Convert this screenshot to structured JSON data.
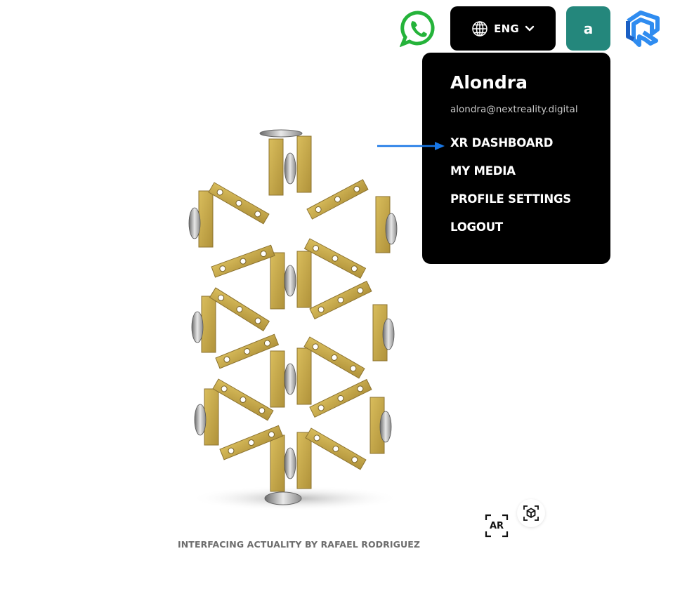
{
  "header": {
    "whatsapp_icon": "whatsapp-icon",
    "language": {
      "icon": "globe-icon",
      "label": "ENG",
      "chevron": "chevron-down-icon"
    },
    "avatar_initial": "a",
    "brand_logo": "next-reality-logo"
  },
  "user_menu": {
    "name": "Alondra",
    "email": "alondra@nextreality.digital",
    "items": [
      {
        "label": "XR DASHBOARD"
      },
      {
        "label": "MY MEDIA"
      },
      {
        "label": "PROFILE SETTINGS"
      },
      {
        "label": "LOGOUT"
      }
    ]
  },
  "annotation": {
    "icon": "arrow-right-icon",
    "color": "#1877e6"
  },
  "viewer": {
    "ar_label": "AR",
    "view_3d_icon": "cube-icon",
    "caption": "INTERFACING ACTUALITY BY RAFAEL RODRIGUEZ"
  },
  "colors": {
    "avatar_bg": "#24877c",
    "menu_bg": "#000000",
    "model_gold": "#c8a94a"
  }
}
